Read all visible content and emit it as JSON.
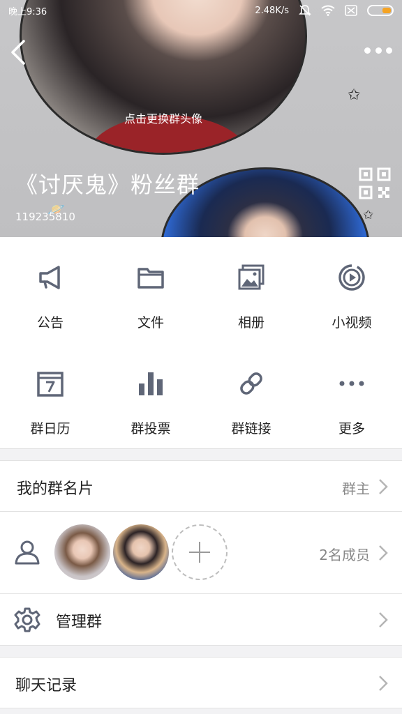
{
  "status_bar": {
    "time": "晚上9:36",
    "speed": "2.48K/s"
  },
  "header": {
    "change_avatar_hint": "点击更换群头像",
    "group_name": "《讨厌鬼》粉丝群",
    "group_id": "119235810"
  },
  "functions": [
    {
      "label": "公告",
      "icon": "megaphone-icon"
    },
    {
      "label": "文件",
      "icon": "folder-icon"
    },
    {
      "label": "相册",
      "icon": "photo-album-icon"
    },
    {
      "label": "小视频",
      "icon": "video-play-icon"
    },
    {
      "label": "群日历",
      "icon": "calendar-icon"
    },
    {
      "label": "群投票",
      "icon": "bar-chart-icon"
    },
    {
      "label": "群链接",
      "icon": "link-icon"
    },
    {
      "label": "更多",
      "icon": "more-dots-icon"
    }
  ],
  "my_card": {
    "title": "我的群名片",
    "value": "群主"
  },
  "members": {
    "count_label": "2名成员"
  },
  "manage": {
    "title": "管理群"
  },
  "chat_history": {
    "title": "聊天记录"
  },
  "colors": {
    "icon_gray": "#5f6677",
    "accent": "#f5a323"
  }
}
